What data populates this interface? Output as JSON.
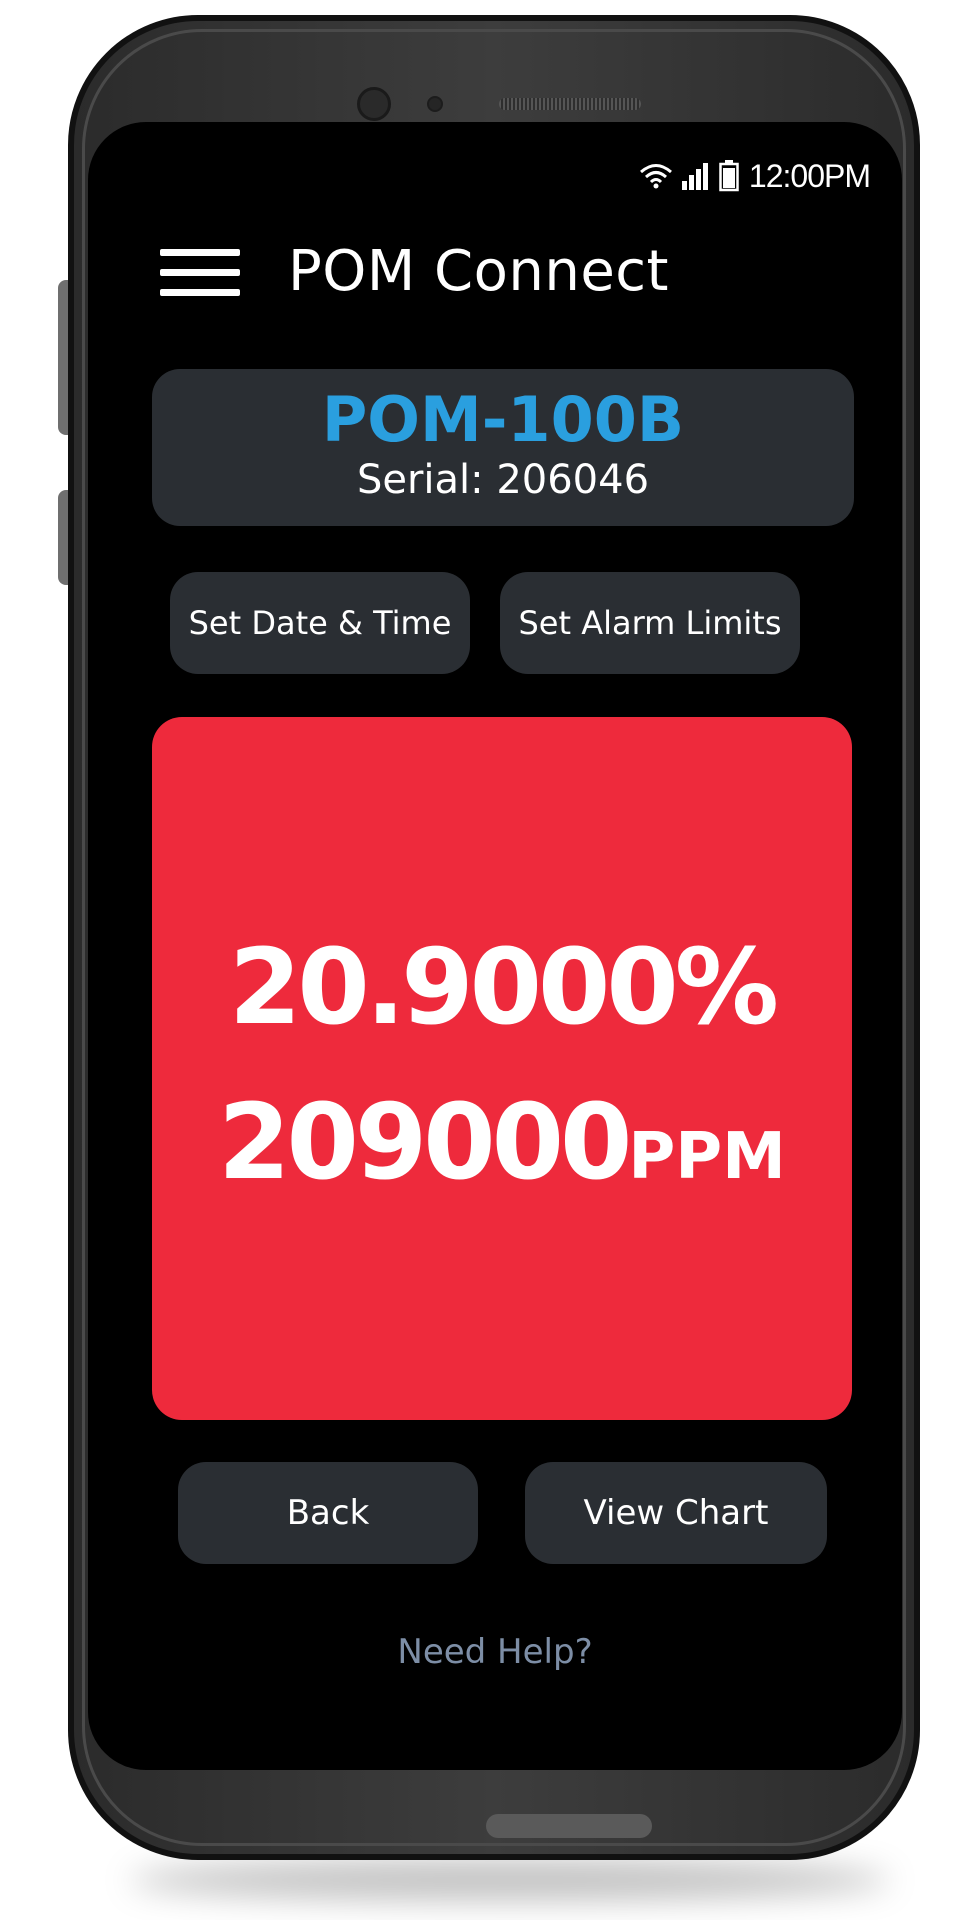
{
  "status_bar": {
    "time": "12:00PM",
    "icons": [
      "wifi-icon",
      "signal-icon",
      "battery-icon"
    ]
  },
  "app": {
    "title": "POM Connect",
    "menu_icon": "hamburger-menu-icon"
  },
  "device": {
    "model": "POM-100B",
    "serial_text": "Serial: 206046"
  },
  "actions": {
    "set_date_time": "Set Date & Time",
    "set_alarm_limits": "Set Alarm Limits",
    "back": "Back",
    "view_chart": "View Chart"
  },
  "reading": {
    "percent_text": "20.9000%",
    "ppm_value": "209000",
    "ppm_unit": "PPM",
    "background_color": "#ee2a3c"
  },
  "footer": {
    "help_link": "Need Help?"
  },
  "colors": {
    "accent": "#2a9fdf",
    "card": "#2a2e33",
    "alarm": "#ee2a3c",
    "help_link": "#7d8ea6"
  }
}
